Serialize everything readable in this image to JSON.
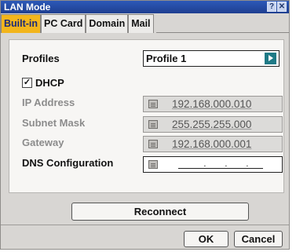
{
  "window": {
    "title": "LAN Mode",
    "help_icon": "question-icon",
    "close_icon": "close-icon"
  },
  "tabs": [
    {
      "label": "Built-in",
      "active": true
    },
    {
      "label": "PC Card",
      "active": false
    },
    {
      "label": "Domain",
      "active": false
    },
    {
      "label": "Mail",
      "active": false
    }
  ],
  "form": {
    "profiles_label": "Profiles",
    "profile_value": "Profile 1",
    "dhcp_label": "DHCP",
    "dhcp_checked": true,
    "dhcp_mark": "✓",
    "ip_label": "IP Address",
    "ip_value": "192.168.000.010",
    "subnet_label": "Subnet Mask",
    "subnet_value": "255.255.255.000",
    "gateway_label": "Gateway",
    "gateway_value": "192.168.000.001",
    "dns_label": "DNS Configuration",
    "dns_value": ". . ."
  },
  "buttons": {
    "reconnect": "Reconnect",
    "ok": "OK",
    "cancel": "Cancel"
  },
  "colors": {
    "title_bar": "#1f3f90",
    "active_tab": "#f2b51c",
    "select_arrow": "#1f7a86"
  }
}
